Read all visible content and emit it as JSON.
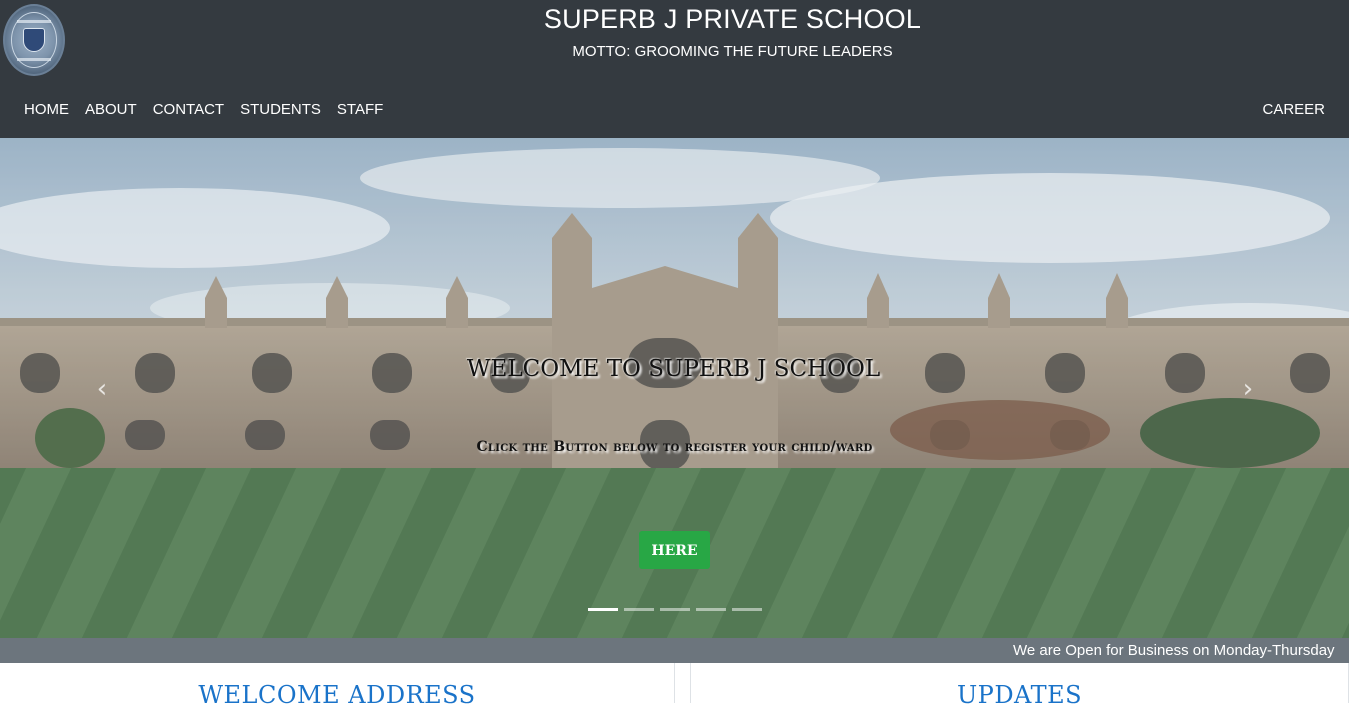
{
  "header": {
    "title": "SUPERB J PRIVATE SCHOOL",
    "motto": "MOTTO: GROOMING THE FUTURE LEADERS",
    "logo_icon": "school-crest-logo"
  },
  "nav": {
    "items": [
      {
        "label": "HOME"
      },
      {
        "label": "ABOUT"
      },
      {
        "label": "CONTACT"
      },
      {
        "label": "STUDENTS"
      },
      {
        "label": "STAFF"
      }
    ],
    "career": "CAREER"
  },
  "hero": {
    "title": "WELCOME TO SUPERB J SCHOOL",
    "subtitle": "Click the Button below to register your child/ward",
    "button_label": "HERE",
    "button_color": "#28a745",
    "prev_icon": "chevron-left-icon",
    "next_icon": "chevron-right-icon",
    "slide_count": 5,
    "active_slide": 1
  },
  "ticker": {
    "text": "We are Open for Business on Monday-Thursday"
  },
  "panels": {
    "left_title": "WELCOME ADDRESS",
    "right_title": "UPDATES"
  },
  "colors": {
    "header_bg": "#343a40",
    "ticker_bg": "#6c757d",
    "heading_blue": "#1a73c9"
  }
}
